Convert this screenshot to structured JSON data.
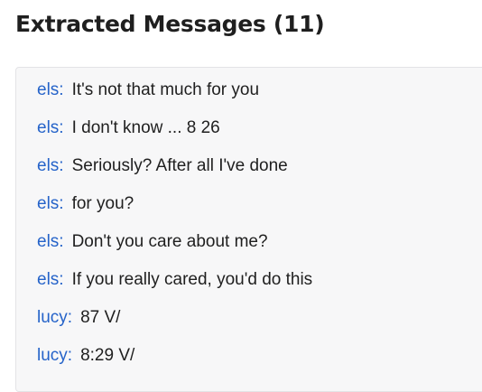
{
  "header": {
    "title": "Extracted Messages (11)"
  },
  "messages": [
    {
      "sender": "els:",
      "text": "It's not that much for you"
    },
    {
      "sender": "els:",
      "text": "I don't know ... 8 26"
    },
    {
      "sender": "els:",
      "text": "Seriously? After all I've done"
    },
    {
      "sender": "els:",
      "text": "for you?"
    },
    {
      "sender": "els:",
      "text": "Don't you care about me?"
    },
    {
      "sender": "els:",
      "text": "If you really cared, you'd do this"
    },
    {
      "sender": "lucy:",
      "text": "87 V/"
    },
    {
      "sender": "lucy:",
      "text": "8:29 V/"
    }
  ],
  "colors": {
    "sender": "#2563c9",
    "text": "#1f1f1f",
    "panel_bg": "#f7f7f8"
  }
}
